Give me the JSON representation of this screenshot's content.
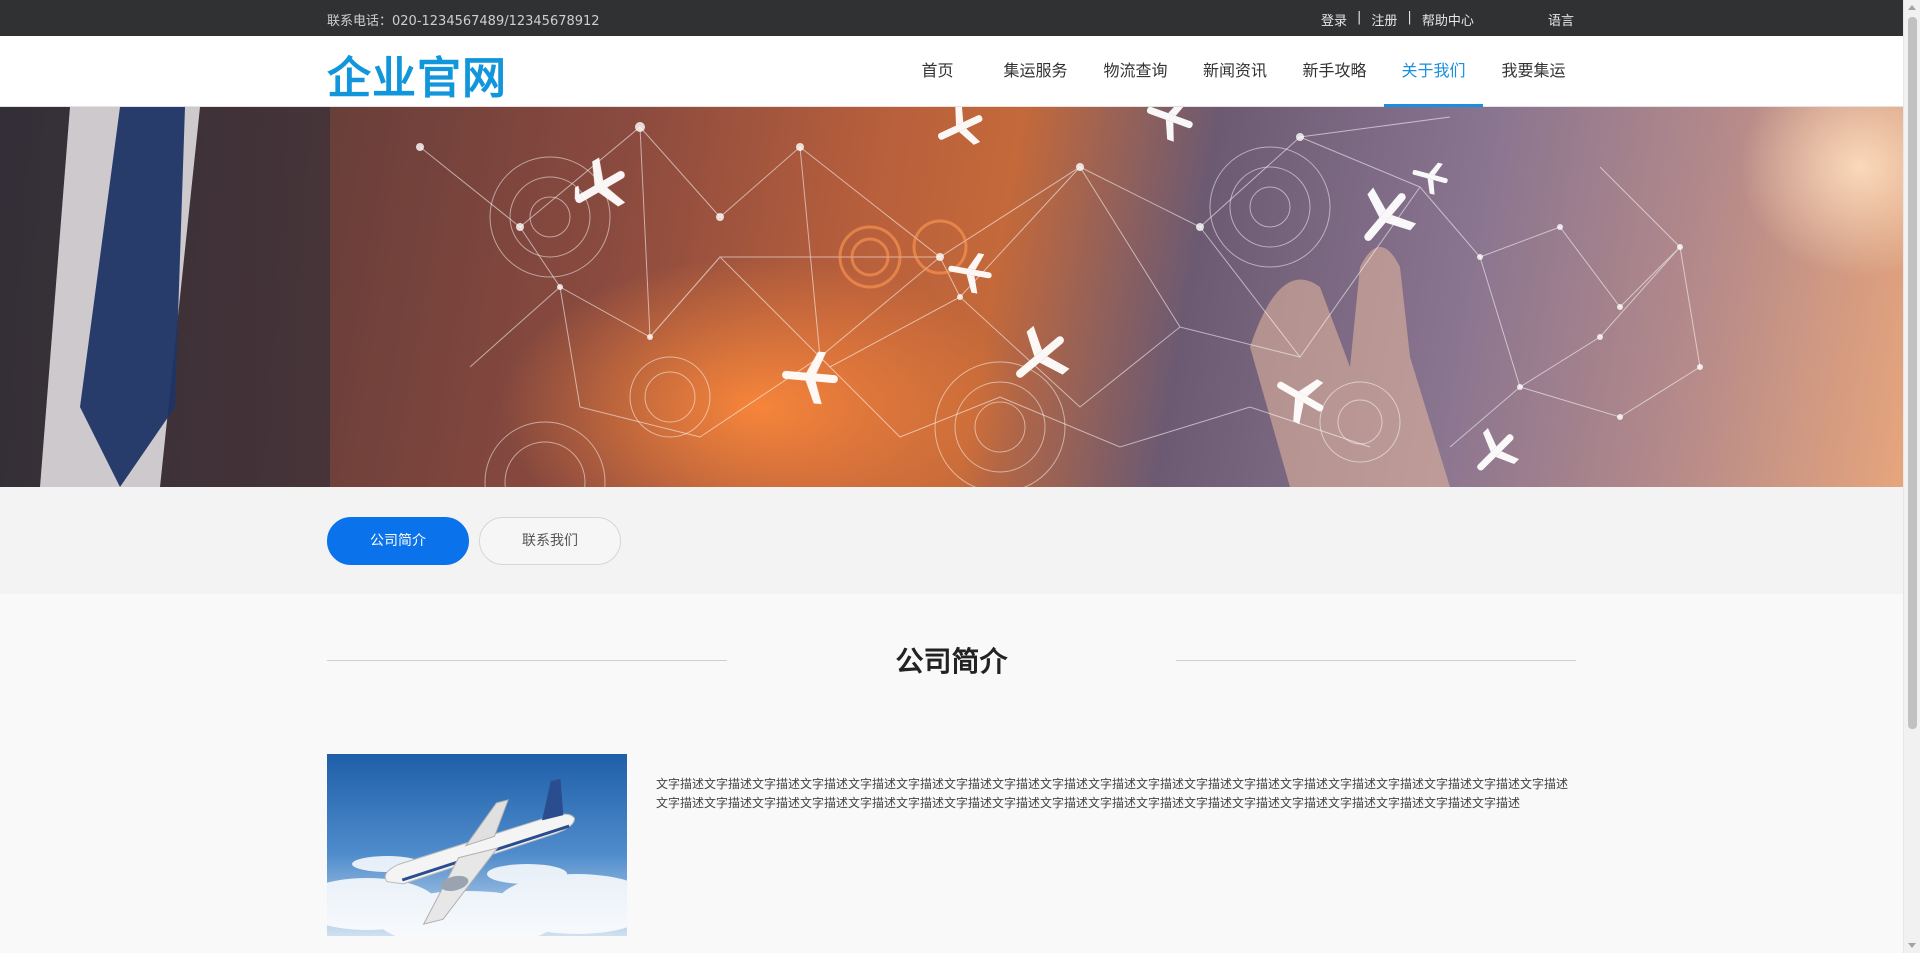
{
  "topbar": {
    "phone": "联系电话：020-1234567489/12345678912",
    "links": [
      "登录",
      "注册",
      "帮助中心"
    ],
    "separator": "|",
    "language": "语言"
  },
  "header": {
    "logo": "企业官网",
    "nav": [
      {
        "label": "首页",
        "active": false
      },
      {
        "label": "集运服务",
        "active": false
      },
      {
        "label": "物流查询",
        "active": false
      },
      {
        "label": "新闻资讯",
        "active": false
      },
      {
        "label": "新手攻略",
        "active": false
      },
      {
        "label": "关于我们",
        "active": true
      },
      {
        "label": "我要集运",
        "active": false
      }
    ],
    "active_color": "#1a8fe0",
    "logo_color": "#1296db"
  },
  "subtabs": {
    "tabs": [
      {
        "label": "公司简介",
        "active": true
      },
      {
        "label": "联系我们",
        "active": false
      }
    ],
    "active_color": "#0a72ea"
  },
  "section": {
    "title": "公司简介",
    "image_icon": "airplane-photo",
    "description": "文字描述文字描述文字描述文字描述文字描述文字描述文字描述文字描述文字描述文字描述文字描述文字描述文字描述文字描述文字描述文字描述文字描述文字描述文字描述文字描述文字描述文字描述文字描述文字描述文字描述文字描述文字描述文字描述文字描述文字描述文字描述文字描述文字描述文字描述文字描述文字描述文字描述"
  }
}
